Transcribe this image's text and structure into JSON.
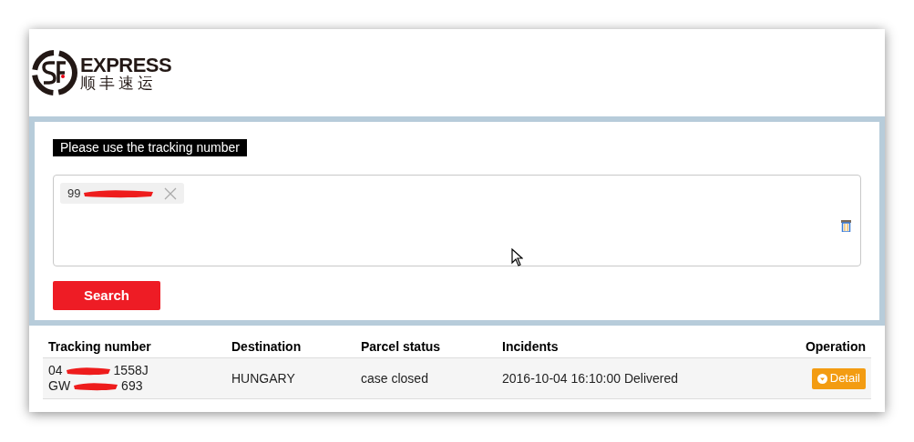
{
  "logo": {
    "wordmark": "EXPRESS",
    "chinese": "顺丰速运"
  },
  "search_panel": {
    "prompt": "Please use the tracking number",
    "tags": [
      {
        "visible_start": "99",
        "redacted": true
      }
    ],
    "search_button": "Search"
  },
  "table": {
    "columns": [
      "Tracking number",
      "Destination",
      "Parcel status",
      "Incidents",
      "Operation"
    ],
    "rows": [
      {
        "tracking_numbers": [
          {
            "visible_start": "04",
            "visible_end": "1558J",
            "redacted": true
          },
          {
            "visible_start": "GW",
            "visible_end": "693",
            "redacted": true
          }
        ],
        "destination": "HUNGARY",
        "status": "case closed",
        "incident": "2016-10-04 16:10:00 Delivered",
        "action": "Detail"
      }
    ]
  }
}
